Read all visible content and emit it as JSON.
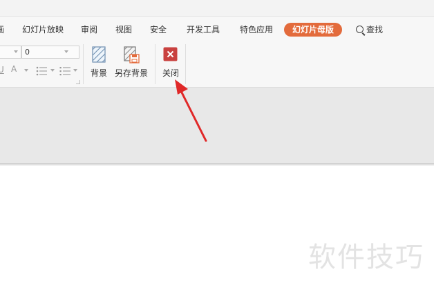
{
  "menu": {
    "partial_tab": "画",
    "tabs": [
      "幻灯片放映",
      "审阅",
      "视图",
      "安全",
      "开发工具",
      "特色应用"
    ],
    "active_tab": "幻灯片母版",
    "search_label": "查找"
  },
  "ribbon": {
    "font_size_value": "0",
    "underline_glyph": "U",
    "background_label": "背景",
    "save_background_label": "另存背景",
    "close_label": "关闭"
  },
  "watermark": "软件技巧",
  "colors": {
    "active_tab": "#e36b3c",
    "close_button": "#c9413f",
    "annotation_arrow": "#e02828"
  }
}
